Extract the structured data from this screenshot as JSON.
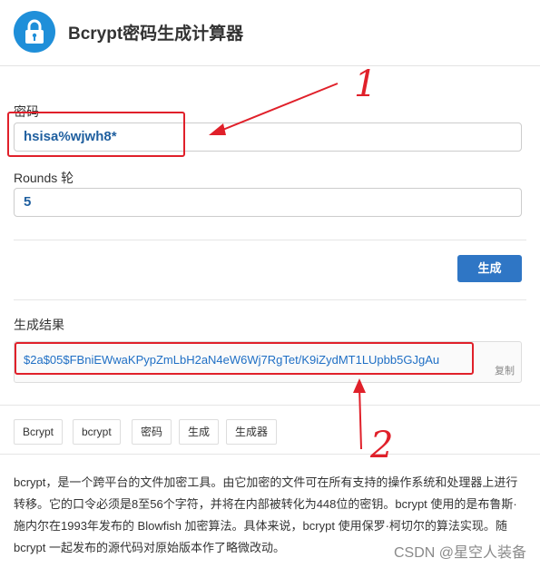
{
  "header": {
    "title": "Bcrypt密码生成计算器",
    "logo_icon": "lock-icon",
    "accent_color": "#1f8fd9"
  },
  "form": {
    "password_label": "密码",
    "password_value": "hsisa%wjwh8*",
    "rounds_label": "Rounds 轮",
    "rounds_value": "5",
    "generate_label": "生成"
  },
  "result": {
    "label": "生成结果",
    "value": "$2a$05$FBniEWwaKPypZmLbH2aN4eW6Wj7RgTet/K9iZydMT1LUpbb5GJgAu",
    "copy_label": "复制"
  },
  "tags": [
    "Bcrypt",
    "bcrypt",
    "密码",
    "生成",
    "生成器"
  ],
  "description": "bcrypt，是一个跨平台的文件加密工具。由它加密的文件可在所有支持的操作系统和处理器上进行转移。它的口令必须是8至56个字符，并将在内部被转化为448位的密钥。bcrypt 使用的是布鲁斯·施内尔在1993年发布的 Blowfish 加密算法。具体来说，bcrypt 使用保罗·柯切尔的算法实现。随 bcrypt 一起发布的源代码对原始版本作了略微改动。",
  "annotations": {
    "mark1": "1",
    "mark2": "2",
    "color": "#e0202a"
  },
  "watermark": "CSDN @星空人装备"
}
